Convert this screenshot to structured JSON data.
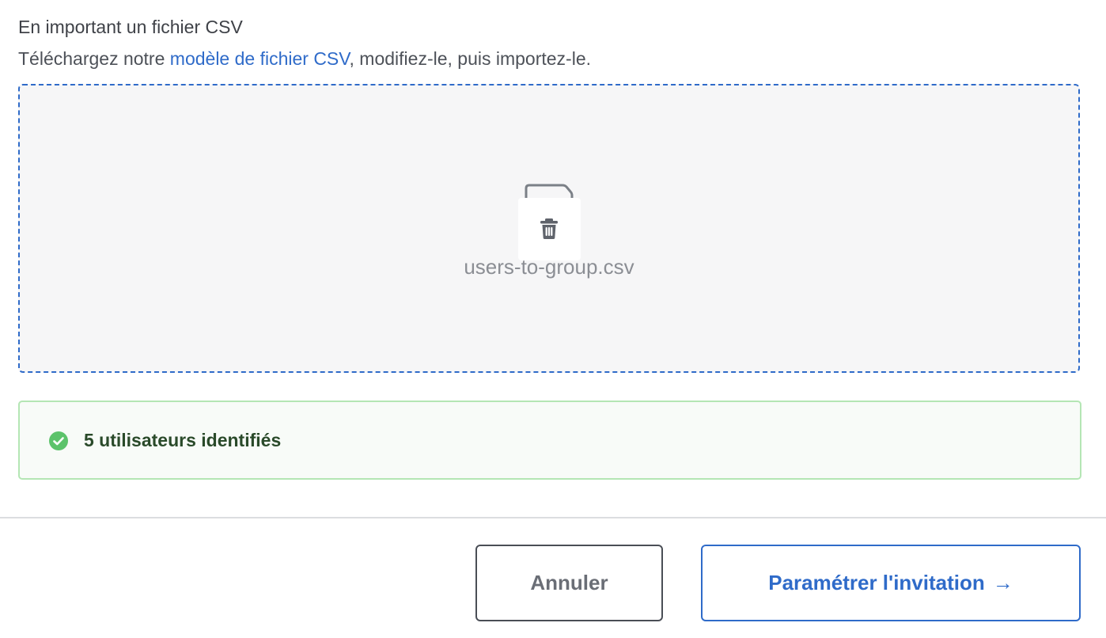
{
  "import_section": {
    "title": "En important un fichier CSV",
    "desc_prefix": "Téléchargez notre ",
    "template_link": "modèle de fichier CSV",
    "desc_suffix": ", modifiez-le, puis importez-le."
  },
  "dropzone": {
    "file_name": "users-to-group.csv",
    "file_icon": "file-icon",
    "delete_icon": "trash-icon"
  },
  "status": {
    "icon": "check-circle-icon",
    "message": "5 utilisateurs identifiés"
  },
  "footer": {
    "cancel_label": "Annuler",
    "primary_label": "Paramétrer l'invitation",
    "primary_arrow": "→"
  },
  "colors": {
    "accent": "#2f6bc9",
    "success": "#5cc36b",
    "success_border": "#b4e6b4"
  }
}
